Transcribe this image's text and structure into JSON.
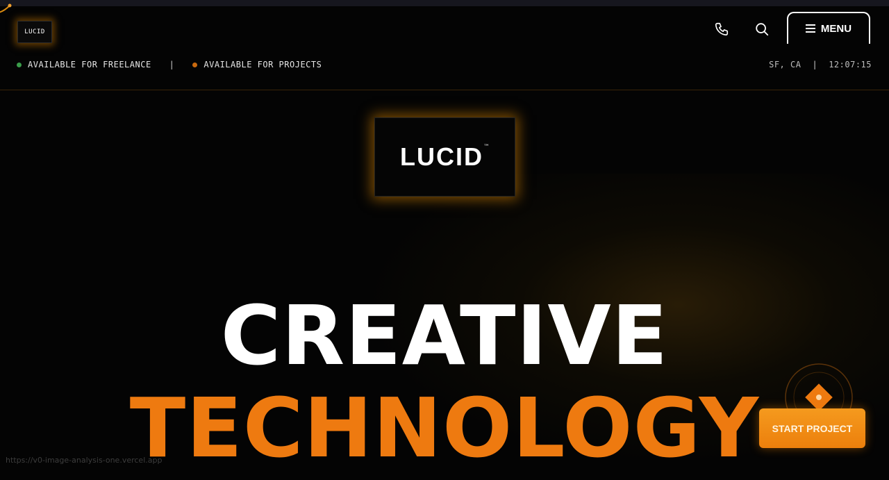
{
  "brand": {
    "small_logo_text": "LUCID",
    "hero_logo_text": "LUCID",
    "hero_logo_mark": "™"
  },
  "header": {
    "phone_icon": "phone-icon",
    "search_icon": "search-icon",
    "menu_label": "MENU"
  },
  "status": {
    "freelance_label": "AVAILABLE FOR FREELANCE",
    "separator": "|",
    "projects_label": "AVAILABLE FOR PROJECTS",
    "location": "SF, CA",
    "clock": "12:07:15"
  },
  "hero": {
    "line1": "CREATIVE",
    "line2": "TECHNOLOGY"
  },
  "cta": {
    "start_label": "START PROJECT"
  },
  "browser": {
    "status_url": "https://v0-image-analysis-one.vercel.app"
  },
  "colors": {
    "accent": "#ee7a10",
    "freelance_dot": "#3a9d4a",
    "projects_dot": "#c9690f",
    "background": "#040404"
  }
}
